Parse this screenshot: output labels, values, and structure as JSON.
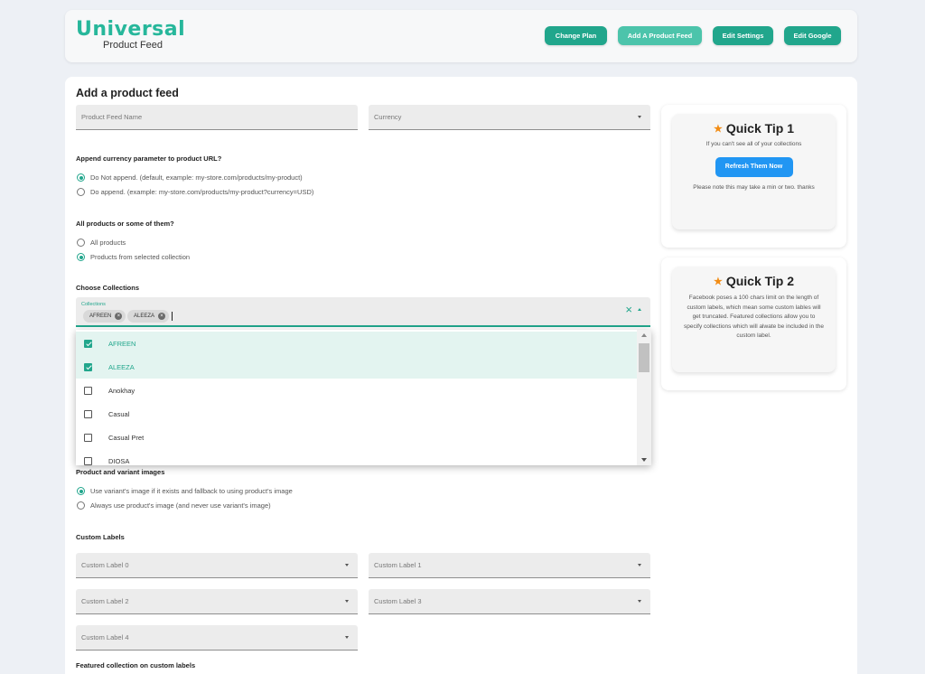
{
  "header": {
    "logo_main": "Universal",
    "logo_sub": "Product Feed",
    "buttons": [
      "Change Plan",
      "Add A Product Feed",
      "Edit Settings",
      "Edit Google"
    ]
  },
  "form": {
    "title": "Add a product feed",
    "feed_name_placeholder": "Product Feed Name",
    "currency_placeholder": "Currency",
    "append_label": "Append currency parameter to product URL?",
    "append_options": [
      "Do Not append. (default, example: my-store.com/products/my-product)",
      "Do append. (example: my-store.com/products/my-product?currency=USD)"
    ],
    "products_label": "All products or some of them?",
    "products_options": [
      "All products",
      "Products from selected collection"
    ],
    "collections_label": "Choose Collections",
    "collections_field_label": "Collections",
    "selected_chips": [
      "AFREEN",
      "ALEEZA"
    ],
    "clear_icon": "×",
    "collection_options": [
      "AFREEN",
      "ALEEZA",
      "Anokhay",
      "Casual",
      "Casual Pret",
      "DIOSA"
    ],
    "images_label": "Product and variant images",
    "images_options": [
      "Use variant's image if it exists and fallback to using product's image",
      "Always use product's image (and never use variant's image)"
    ],
    "custom_labels_label": "Custom Labels",
    "custom_labels": [
      "Custom Label 0",
      "Custom Label 1",
      "Custom Label 2",
      "Custom Label 3",
      "Custom Label 4"
    ],
    "featured_label": "Featured collection on custom labels"
  },
  "tips": [
    {
      "title": "Quick Tip 1",
      "line1": "If you can't see all of your collections",
      "button": "Refresh Them Now",
      "line2": "Please note this may take a min or two. thanks"
    },
    {
      "title": "Quick Tip 2",
      "text": "Facebook poses a 100 chars limit on the length of custom labels, which mean some custom lables will get truncated. Featured collections allow you to specify collections which will alwate be included in the custom label."
    }
  ],
  "colors": {
    "accent": "#21a68c",
    "accent_light": "#4cc4ab",
    "tip_button": "#2196f3",
    "star": "#f28c14"
  }
}
